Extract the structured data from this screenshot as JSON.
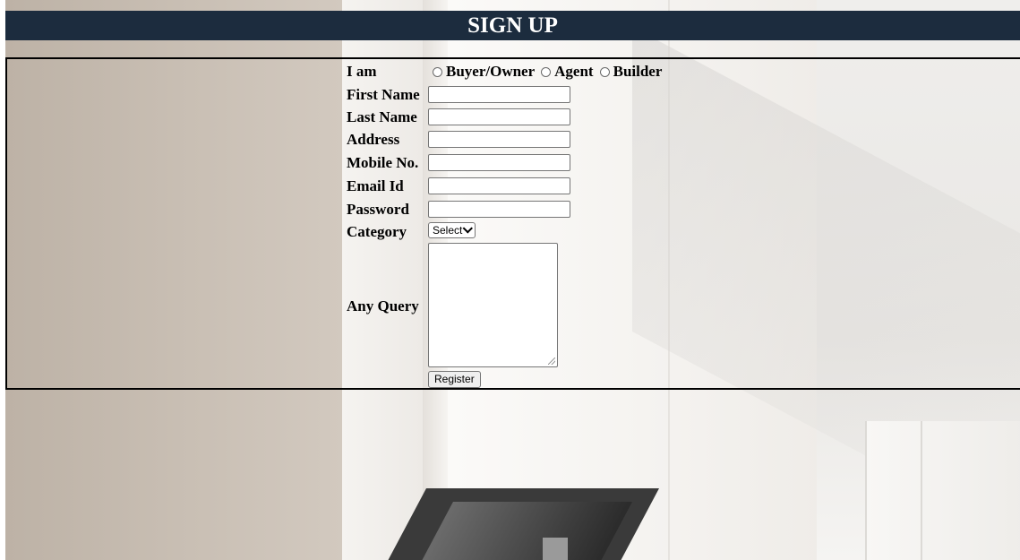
{
  "header": {
    "title": "SIGN UP"
  },
  "form": {
    "role": {
      "label": "I am",
      "options": [
        "Buyer/Owner",
        "Agent",
        "Builder"
      ]
    },
    "first_name": {
      "label": "First Name",
      "value": ""
    },
    "last_name": {
      "label": "Last Name",
      "value": ""
    },
    "address": {
      "label": "Address",
      "value": ""
    },
    "mobile": {
      "label": "Mobile No.",
      "value": ""
    },
    "email": {
      "label": "Email Id",
      "value": ""
    },
    "password": {
      "label": "Password",
      "value": ""
    },
    "category": {
      "label": "Category",
      "selected": "Select"
    },
    "query": {
      "label": "Any Query",
      "value": ""
    },
    "submit_label": "Register"
  },
  "colors": {
    "header_bg": "#1c2c3e",
    "header_text": "#ffffff",
    "form_border": "#000000"
  }
}
